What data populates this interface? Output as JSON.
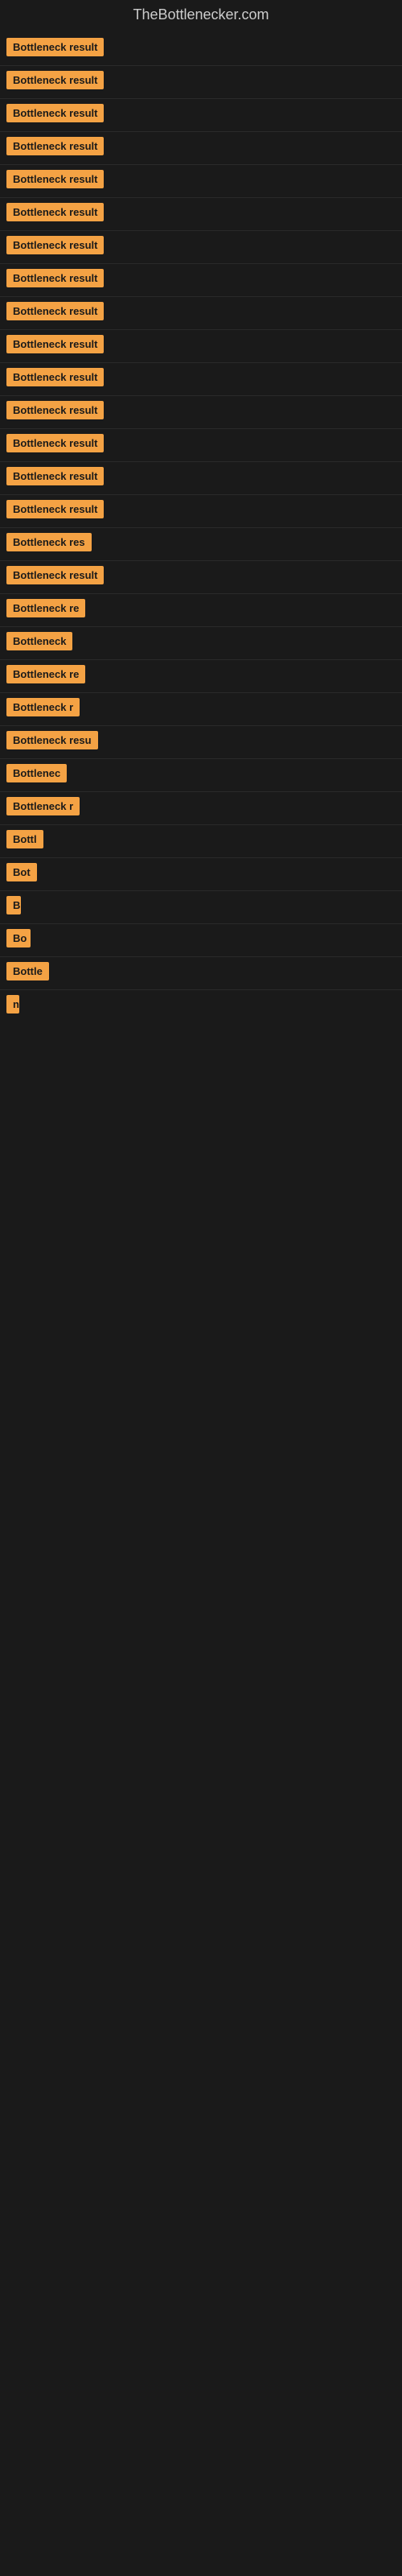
{
  "site": {
    "title": "TheBottlenecker.com"
  },
  "items": [
    {
      "id": 1,
      "label": "Bottleneck result",
      "width": 150
    },
    {
      "id": 2,
      "label": "Bottleneck result",
      "width": 145
    },
    {
      "id": 3,
      "label": "Bottleneck result",
      "width": 145
    },
    {
      "id": 4,
      "label": "Bottleneck result",
      "width": 140
    },
    {
      "id": 5,
      "label": "Bottleneck result",
      "width": 148
    },
    {
      "id": 6,
      "label": "Bottleneck result",
      "width": 143
    },
    {
      "id": 7,
      "label": "Bottleneck result",
      "width": 148
    },
    {
      "id": 8,
      "label": "Bottleneck result",
      "width": 145
    },
    {
      "id": 9,
      "label": "Bottleneck result",
      "width": 148
    },
    {
      "id": 10,
      "label": "Bottleneck result",
      "width": 142
    },
    {
      "id": 11,
      "label": "Bottleneck result",
      "width": 145
    },
    {
      "id": 12,
      "label": "Bottleneck result",
      "width": 140
    },
    {
      "id": 13,
      "label": "Bottleneck result",
      "width": 143
    },
    {
      "id": 14,
      "label": "Bottleneck result",
      "width": 140
    },
    {
      "id": 15,
      "label": "Bottleneck result",
      "width": 138
    },
    {
      "id": 16,
      "label": "Bottleneck res",
      "width": 120
    },
    {
      "id": 17,
      "label": "Bottleneck result",
      "width": 138
    },
    {
      "id": 18,
      "label": "Bottleneck re",
      "width": 112
    },
    {
      "id": 19,
      "label": "Bottleneck",
      "width": 90
    },
    {
      "id": 20,
      "label": "Bottleneck re",
      "width": 110
    },
    {
      "id": 21,
      "label": "Bottleneck r",
      "width": 100
    },
    {
      "id": 22,
      "label": "Bottleneck resu",
      "width": 118
    },
    {
      "id": 23,
      "label": "Bottlenec",
      "width": 85
    },
    {
      "id": 24,
      "label": "Bottleneck r",
      "width": 98
    },
    {
      "id": 25,
      "label": "Bottl",
      "width": 55
    },
    {
      "id": 26,
      "label": "Bot",
      "width": 42
    },
    {
      "id": 27,
      "label": "B",
      "width": 18
    },
    {
      "id": 28,
      "label": "Bo",
      "width": 30
    },
    {
      "id": 29,
      "label": "Bottle",
      "width": 58
    },
    {
      "id": 30,
      "label": "n",
      "width": 14
    }
  ]
}
